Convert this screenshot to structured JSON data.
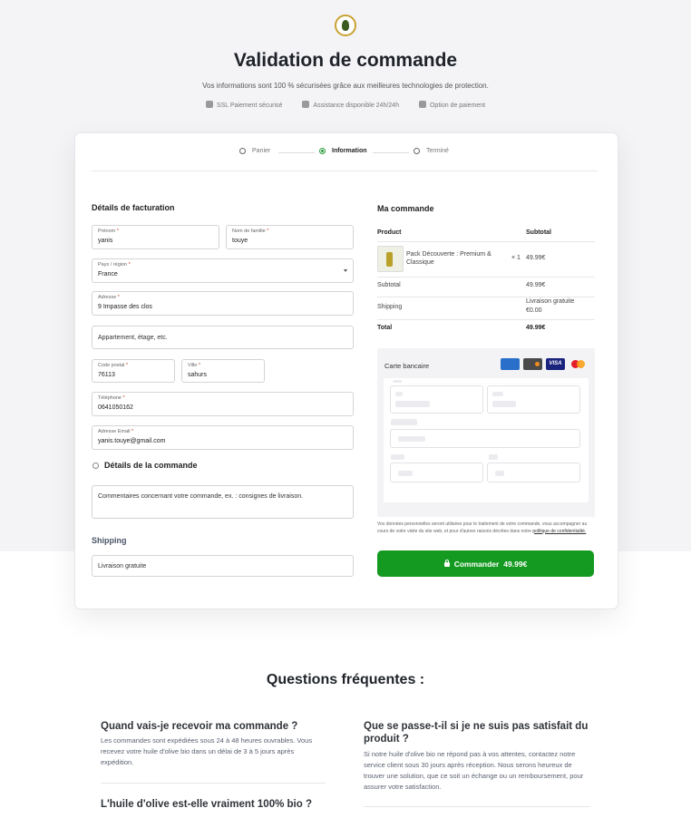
{
  "header": {
    "title": "Validation de commande",
    "subtitle": "Vos informations sont 100 % sécurisées grâce aux meilleures technologies de protection.",
    "assurances": [
      "SSL Paiement sécurisé",
      "Assistance disponible 24h/24h",
      "Option de paiement"
    ]
  },
  "steps": [
    "Panier",
    "Information",
    "Terminé"
  ],
  "billing": {
    "heading": "Détails de facturation",
    "firstname_label": "Prénom",
    "firstname_value": "yanis",
    "lastname_label": "Nom de famille",
    "lastname_value": "touye",
    "country_label": "Pays / région",
    "country_value": "France",
    "address_label": "Adresse",
    "address_value": "9 Impasse des clos",
    "address2_placeholder": "Appartement, étage, etc.",
    "postcode_label": "Code postal",
    "postcode_value": "76113",
    "city_label": "Ville",
    "city_value": "sahurs",
    "phone_label": "Téléphone",
    "phone_value": "0641050162",
    "email_label": "Adresse Email",
    "email_value": "yanis.touye@gmail.com",
    "required_mark": "*",
    "order_details_label": "Détails de la commande",
    "comments_placeholder": "Commentaires concernant votre commande, ex. : consignes de livraison.",
    "shipping_heading": "Shipping",
    "shipping_value": "Livraison gratuite"
  },
  "order": {
    "heading": "Ma commande",
    "col_product": "Product",
    "col_subtotal": "Subtotal",
    "item_name": "Pack Découverte : Premium & Classique",
    "item_qty": "× 1",
    "item_price": "49.99€",
    "subtotal_label": "Subtotal",
    "subtotal_value": "49.99€",
    "shipping_label": "Shipping",
    "shipping_value": "Livraison gratuite",
    "shipping_amount": "€0.00",
    "total_label": "Total",
    "total_value": "49.99€"
  },
  "payment": {
    "label": "Carte bancaire",
    "brands": [
      "amex-icon",
      "discover-icon",
      "visa-icon",
      "mastercard-icon"
    ],
    "visa_text": "VISA"
  },
  "privacy": {
    "text": "Vos données personnelles seront utilisées pour le traitement de votre commande, vous accompagner au cours de votre visite du site web, et pour d'autres raisons décrites dans notre",
    "link": "politique de confidentialité."
  },
  "cta": {
    "label": "Commander",
    "amount": "49.99€",
    "color": "#159a21"
  },
  "faq": {
    "title": "Questions fréquentes :",
    "items": [
      {
        "q": "Quand vais-je recevoir ma commande ?",
        "a": "Les commandes sont expédiées sous 24 à 48 heures ouvrables. Vous recevez votre huile d'olive bio dans un délai de 3 à 5 jours après expédition."
      },
      {
        "q": "Que se passe-t-il si je ne suis pas satisfait du produit ?",
        "a": "Si notre huile d'olive bio ne répond pas à vos attentes, contactez notre service client sous 30 jours après réception. Nous serons heureux de trouver une solution, que ce soit un échange ou un remboursement, pour assurer votre satisfaction."
      },
      {
        "q": "L'huile d'olive est-elle vraiment 100% bio ?",
        "a": ""
      }
    ]
  }
}
